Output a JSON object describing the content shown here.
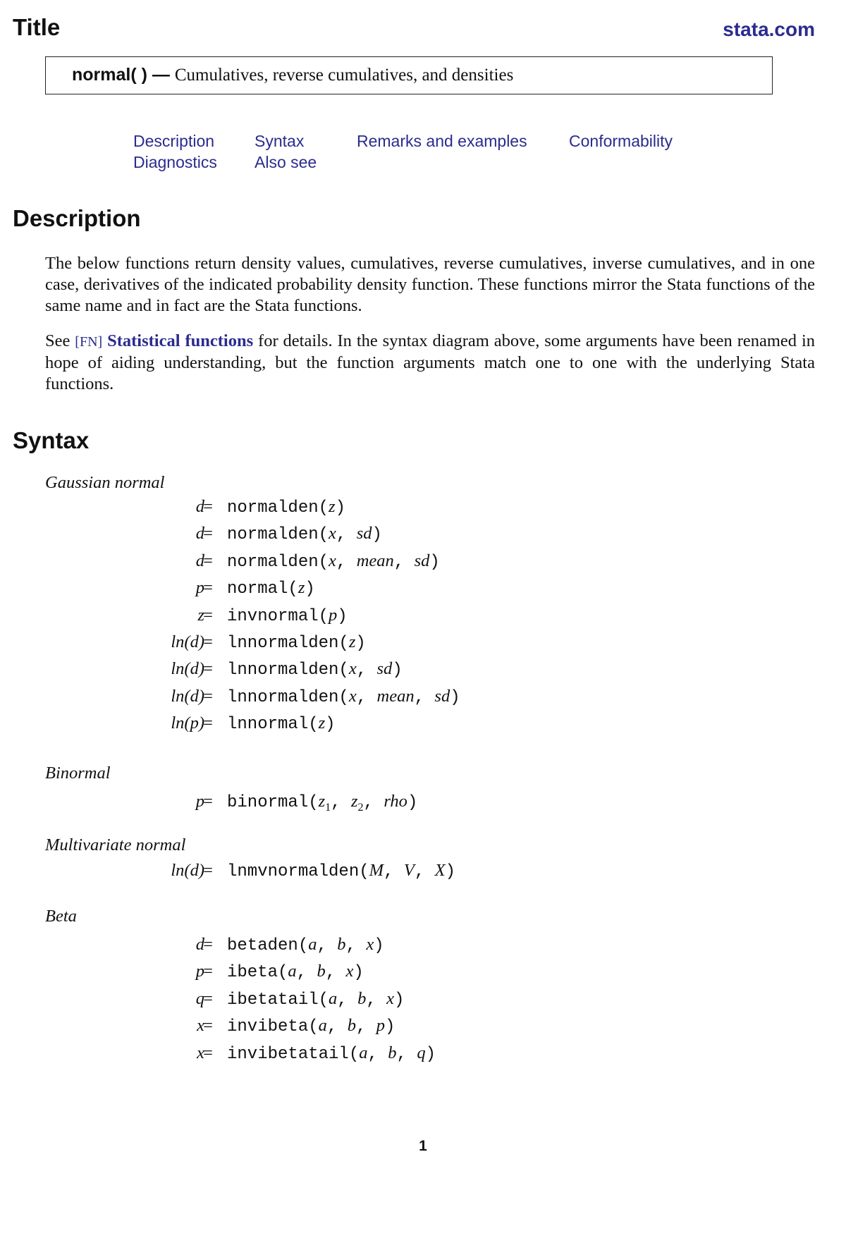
{
  "header": {
    "title": "Title",
    "site": "stata.com",
    "colors": {
      "link": "#2b2b8f",
      "text": "#111111"
    }
  },
  "title_box": {
    "function": "normal( )",
    "dash": " — ",
    "subtitle": "Cumulatives, reverse cumulatives, and densities"
  },
  "nav": {
    "links": [
      "Description",
      "Syntax",
      "Remarks and examples",
      "Conformability",
      "Diagnostics",
      "Also see"
    ]
  },
  "description": {
    "heading": "Description",
    "para1": "The below functions return density values, cumulatives, reverse cumulatives, inverse cumulatives, and in one case, derivatives of the indicated probability density function. These functions mirror the Stata functions of the same name and in fact are the Stata functions.",
    "para2_prefix": "See ",
    "para2_tag": "[FN]",
    "para2_link": "Statistical functions",
    "para2_suffix": " for details. In the syntax diagram above, some arguments have been renamed in hope of aiding understanding, but the function arguments match one to one with the underlying Stata functions."
  },
  "syntax": {
    "heading": "Syntax",
    "groups": [
      {
        "label": "Gaussian normal",
        "equations": [
          {
            "lhs": "d",
            "fn": "normalden",
            "args": [
              "z"
            ]
          },
          {
            "lhs": "d",
            "fn": "normalden",
            "args": [
              "x",
              "sd"
            ]
          },
          {
            "lhs": "d",
            "fn": "normalden",
            "args": [
              "x",
              "mean",
              "sd"
            ]
          },
          {
            "lhs": "p",
            "fn": "normal",
            "args": [
              "z"
            ]
          },
          {
            "lhs": "z",
            "fn": "invnormal",
            "args": [
              "p"
            ]
          },
          {
            "lhs": "ln(d)",
            "fn": "lnnormalden",
            "args": [
              "z"
            ]
          },
          {
            "lhs": "ln(d)",
            "fn": "lnnormalden",
            "args": [
              "x",
              "sd"
            ]
          },
          {
            "lhs": "ln(d)",
            "fn": "lnnormalden",
            "args": [
              "x",
              "mean",
              "sd"
            ]
          },
          {
            "lhs": "ln(p)",
            "fn": "lnnormal",
            "args": [
              "z"
            ]
          }
        ]
      },
      {
        "label": "Binormal",
        "equations": [
          {
            "lhs": "p",
            "fn": "binormal",
            "args": [
              "z|1",
              "z|2",
              "rho"
            ]
          }
        ]
      },
      {
        "label": "Multivariate normal",
        "equations": [
          {
            "lhs": "ln(d)",
            "fn": "lnmvnormalden",
            "args": [
              "M",
              "V",
              "X"
            ]
          }
        ]
      },
      {
        "label": "Beta",
        "equations": [
          {
            "lhs": "d",
            "fn": "betaden",
            "args": [
              "a",
              "b",
              "x"
            ]
          },
          {
            "lhs": "p",
            "fn": "ibeta",
            "args": [
              "a",
              "b",
              "x"
            ]
          },
          {
            "lhs": "q",
            "fn": "ibetatail",
            "args": [
              "a",
              "b",
              "x"
            ]
          },
          {
            "lhs": "x",
            "fn": "invibeta",
            "args": [
              "a",
              "b",
              "p"
            ]
          },
          {
            "lhs": "x",
            "fn": "invibetatail",
            "args": [
              "a",
              "b",
              "q"
            ]
          }
        ]
      }
    ]
  },
  "footer": {
    "page_number": "1"
  }
}
